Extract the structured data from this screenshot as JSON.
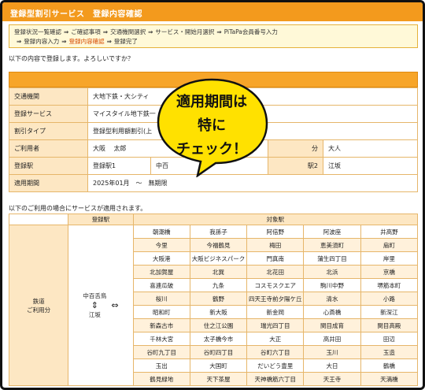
{
  "title": "登録型割引サービス　登録内容確認",
  "steps": {
    "s1": "登録状況一覧確認",
    "s2": "ご確認事項",
    "s3": "交通機関選択",
    "s4": "サービス・開始月選択",
    "s5": "PiTaPa会員番号入力",
    "s6": "登録内容入力",
    "s7": "登録内容確認",
    "s8": "登録完了",
    "arrow": "⇒"
  },
  "intro": "以下の内容で登録します。よろしいですか？",
  "info": {
    "transport_label": "交通機関",
    "transport_value": "大地下鉄・大シティ",
    "service_label": "登録サービス",
    "service_value": "マイスタイル地下鉄一",
    "discount_label": "割引タイプ",
    "discount_value": "登録型利用額割引(上",
    "user_label": "ご利用者",
    "user_area": "大阪",
    "user_name": "太郎",
    "user_type_label": "分",
    "user_type_value": "大人",
    "station_label": "登録駅",
    "station1_label": "登録駅1",
    "station1_value": "中百",
    "station2_label": "駅2",
    "station2_value": "江坂",
    "period_label": "適用期間",
    "period_value": "2025年01月　～　無期限"
  },
  "bubble": {
    "line1": "適用期間は",
    "line2": "特に",
    "line3": "チェック！",
    "color": "#ffe100"
  },
  "note": "以下のご利用の場合にサービスが適用されます。",
  "stations": {
    "header_reg": "登録駅",
    "header_target": "対象駅",
    "side_label_1": "鉄道",
    "side_label_2": "ご利用分",
    "from_top": "中百舌鳥",
    "from_swap": "⇕",
    "from_bottom": "江坂",
    "arrow_lr": "⇔",
    "rows": [
      [
        "朝潮橋",
        "我孫子",
        "阿倍野",
        "阿波座",
        "井高野"
      ],
      [
        "今里",
        "今福鶴見",
        "梅田",
        "恵美須町",
        "扇町"
      ],
      [
        "大阪港",
        "大阪ビジネスパーク",
        "門真南",
        "蒲生四丁目",
        "岸里"
      ],
      [
        "北加賀屋",
        "北巽",
        "北花田",
        "北浜",
        "京橋"
      ],
      [
        "喜連瓜破",
        "九条",
        "コスモスクエア",
        "駒川中野",
        "堺筋本町"
      ],
      [
        "桜川",
        "鶴野",
        "四天王寺前夕陽ケ丘",
        "清水",
        "小路"
      ],
      [
        "昭和町",
        "新大阪",
        "新金岡",
        "心斎橋",
        "新深江"
      ],
      [
        "新森古市",
        "住之江公園",
        "瑞光四丁目",
        "関目成育",
        "関目高殿"
      ],
      [
        "千林大宮",
        "太子橋今市",
        "大正",
        "高井田",
        "田辺"
      ],
      [
        "谷町九丁目",
        "谷町四丁目",
        "谷町六丁目",
        "玉川",
        "玉造"
      ],
      [
        "玉出",
        "大国町",
        "だいどう豊里",
        "大日",
        "鶴橋"
      ],
      [
        "鶴見緑地",
        "天下茶屋",
        "天神橋筋六丁目",
        "天王寺",
        "天満橋"
      ]
    ]
  }
}
